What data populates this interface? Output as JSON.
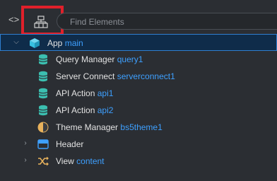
{
  "toolbar": {
    "code_toggle_icon": "code-brackets-icon",
    "structure_icon": "structure-tree-icon",
    "search_placeholder": "Find Elements"
  },
  "tree": {
    "app": {
      "name": "App",
      "id": "main",
      "icon": "app-cube-icon",
      "expanded": true
    },
    "children": [
      {
        "name": "Query Manager",
        "id": "query1",
        "icon": "database-icon"
      },
      {
        "name": "Server Connect",
        "id": "serverconnect1",
        "icon": "database-icon"
      },
      {
        "name": "API Action",
        "id": "api1",
        "icon": "database-icon"
      },
      {
        "name": "API Action",
        "id": "api2",
        "icon": "database-icon"
      },
      {
        "name": "Theme Manager",
        "id": "bs5theme1",
        "icon": "theme-half-circle-icon"
      }
    ],
    "header": {
      "name": "Header",
      "icon": "header-panel-icon",
      "expanded": false
    },
    "view": {
      "name": "View",
      "id": "content",
      "icon": "shuffle-icon",
      "expanded": false
    }
  },
  "colors": {
    "background": "#2b2e33",
    "selection": "#0f2c4a",
    "selection_border": "#2f7fd0",
    "id_text": "#3ea0ff",
    "highlight_box": "#e0202a",
    "database_icon": "#3bbfb0",
    "cube_icon": "#37c0e0"
  }
}
